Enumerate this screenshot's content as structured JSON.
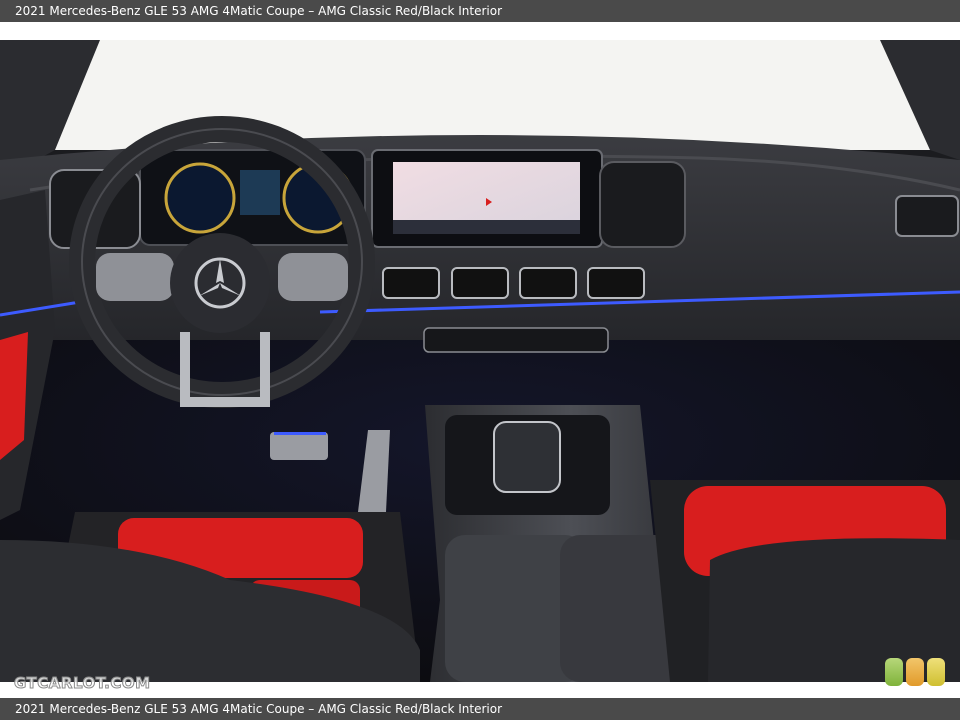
{
  "caption": {
    "top": "2021 Mercedes-Benz GLE 53 AMG 4Matic Coupe – AMG Classic Red/Black Interior",
    "bottom": "2021 Mercedes-Benz GLE 53 AMG 4Matic Coupe – AMG Classic Red/Black Interior"
  },
  "watermark": {
    "text": "GTCARLOT.COM"
  },
  "colors": {
    "caption_bar": "#4a4a4a",
    "seat_red": "#d81e1e",
    "ambient_blue": "#3d5bff",
    "dashboard": "#2a2b2f"
  },
  "icons": {
    "badge": "three-color-dots-icon",
    "steering_logo": "mercedes-star-icon"
  }
}
